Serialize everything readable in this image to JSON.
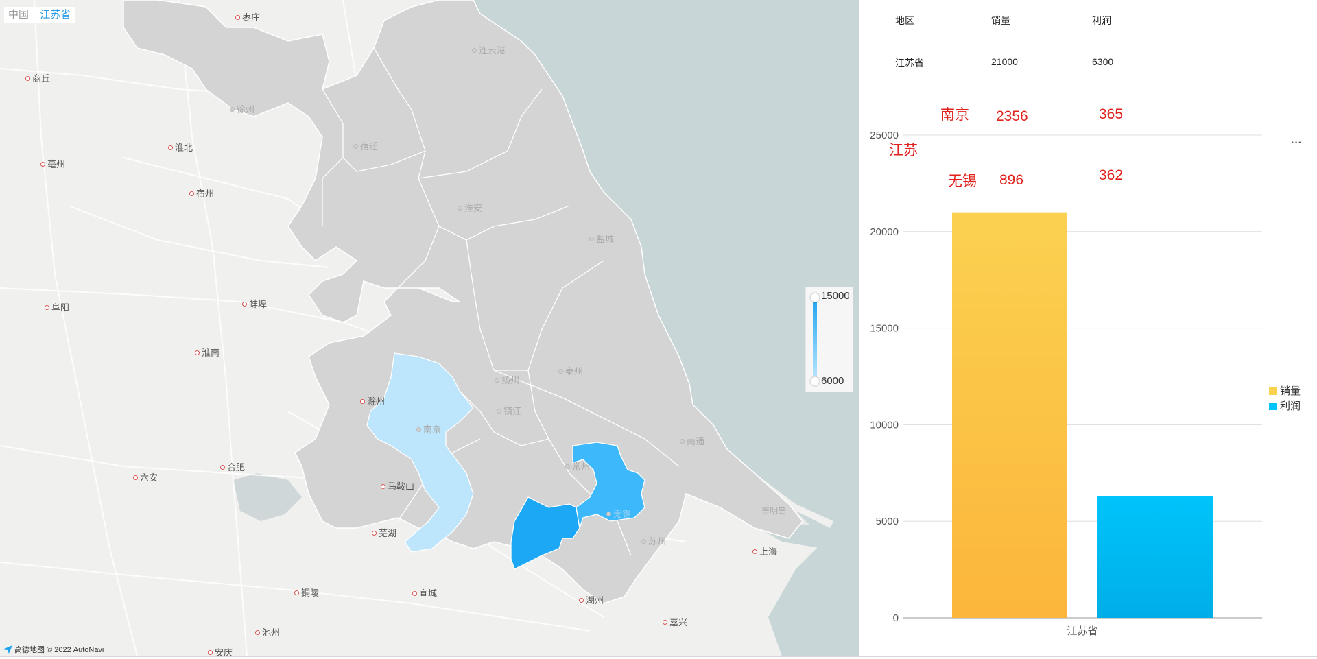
{
  "breadcrumb": {
    "root": "中国",
    "current": "江苏省"
  },
  "map": {
    "colors": {
      "ocean": "#c8d6d8",
      "land": "#f0f0ef",
      "province": "#d4d4d4",
      "province_border": "#ffffff",
      "nanjing": "#bde6fd",
      "wuxi": "#3db8fb",
      "changzhou_south": "#1da8f6",
      "road": "#ffffff"
    },
    "cities_outside": [
      "枣庄",
      "商丘",
      "淮北",
      "亳州",
      "宿州",
      "阜阳",
      "蚌埠",
      "淮南",
      "滁州",
      "六安",
      "合肥",
      "马鞍山",
      "芜湖",
      "铜陵",
      "宣城",
      "池州",
      "安庆",
      "湖州",
      "嘉兴",
      "上海",
      "崇明岛"
    ],
    "cities_inside": [
      "连云港",
      "徐州",
      "宿迁",
      "淮安",
      "盐城",
      "扬州",
      "泰州",
      "镇江",
      "南京",
      "南通",
      "常州",
      "无锡",
      "苏州"
    ],
    "legend": {
      "max": "15000",
      "min": "6000"
    },
    "attribution": "高德地图 © 2022 AutoNavi"
  },
  "table": {
    "headers": [
      "地区",
      "销量",
      "利润"
    ],
    "rows": [
      [
        "江苏省",
        "21000",
        "6300"
      ]
    ]
  },
  "annotations": {
    "row1": [
      "南京",
      "2356",
      "365"
    ],
    "province": "江苏",
    "row2": [
      "无锡",
      "896",
      "362"
    ]
  },
  "menu_icon": "more-icon",
  "more_label": "···",
  "chart_data": {
    "type": "bar",
    "categories": [
      "江苏省"
    ],
    "series": [
      {
        "name": "销量",
        "values": [
          21000
        ],
        "color_top": "#fbd151",
        "color_bottom": "#fbb63b"
      },
      {
        "name": "利润",
        "values": [
          6300
        ],
        "color_top": "#00c4fb",
        "color_bottom": "#00aee7"
      }
    ],
    "ylim": [
      0,
      25000
    ],
    "yticks": [
      0,
      5000,
      10000,
      15000,
      20000,
      25000
    ],
    "grid": true,
    "legend": "right"
  }
}
